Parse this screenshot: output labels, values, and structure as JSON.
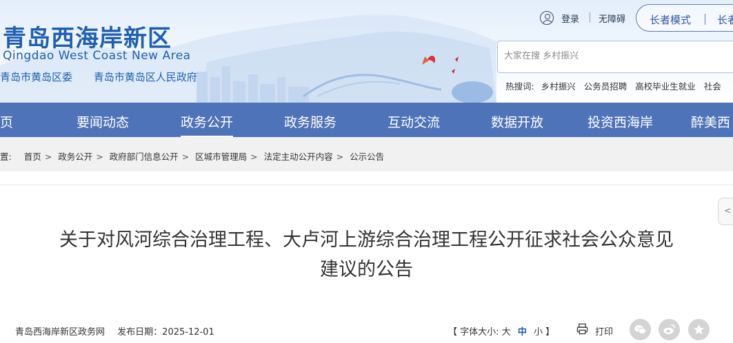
{
  "header": {
    "title_cn": "青岛西海岸新区",
    "title_en": "Qingdao West Coast New Area",
    "sub_links": [
      "青岛市黄岛区委",
      "青岛市黄岛区人民政府"
    ],
    "login": "登录",
    "accessibility": "无障碍",
    "mode_elder": "长者模式",
    "mode_elder_partial": "长者"
  },
  "search": {
    "placeholder": "大家在搜 乡村振兴",
    "hot_label": "热搜词:",
    "hot_terms": [
      "乡村振兴",
      "公务员招聘",
      "高校毕业生就业",
      "社会"
    ]
  },
  "nav": {
    "items": [
      "页",
      "要闻动态",
      "政务公开",
      "政务服务",
      "互动交流",
      "数据开放",
      "投资西海岸",
      "醉美西"
    ],
    "active_index": 2
  },
  "breadcrumb": {
    "label": "置:",
    "items": [
      "首页",
      "政务公开",
      "政府部门信息公开",
      "区城市管理局",
      "法定主动公开内容",
      "公示公告"
    ]
  },
  "article": {
    "title_line1": "关于对风河综合治理工程、大卢河上游综合治理工程公开征求社会公众意见",
    "title_line2": "建议的公告",
    "source": "青岛西海岸新区政务网",
    "date_label": "发布日期：",
    "date": "2025-12-01",
    "fontsize_prefix": "【 字体大小: ",
    "fontsize_large": "大",
    "fontsize_medium": "中",
    "fontsize_small": "小",
    "fontsize_suffix": " 】",
    "print": "打印",
    "share_toggle": "<"
  },
  "colors": {
    "nav_bg": "#4f73b8",
    "title_blue": "#1f5fb1",
    "breadcrumb_bg": "#f1f1f1",
    "share_grey": "#d4d4d4"
  },
  "icons": {
    "user": "user-icon",
    "print": "print-icon",
    "wechat": "wechat-icon",
    "weibo": "weibo-icon",
    "favorite": "star-icon"
  }
}
